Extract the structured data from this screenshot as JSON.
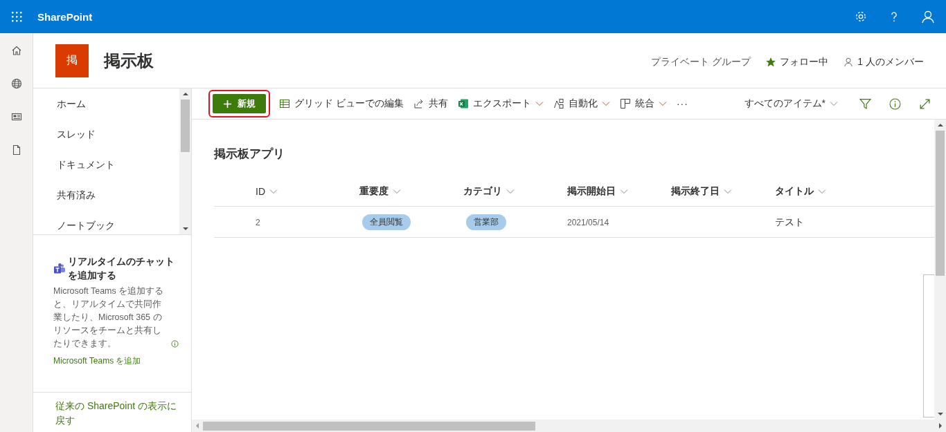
{
  "app_bar": {
    "title": "SharePoint"
  },
  "site": {
    "logo_letter": "掲",
    "title": "掲示板",
    "privacy": "プライベート グループ",
    "follow": {
      "label": "フォロー中",
      "following": true
    },
    "members": "1 人のメンバー"
  },
  "nav": {
    "items": [
      {
        "label": "ホーム"
      },
      {
        "label": "スレッド"
      },
      {
        "label": "ドキュメント"
      },
      {
        "label": "共有済み"
      },
      {
        "label": "ノートブック"
      }
    ],
    "teams_promo": {
      "heading": "リアルタイムのチャットを追加する",
      "body": "Microsoft Teams を追加すると、リアルタイムで共同作業したり、Microsoft 365 のリソースをチームと共有したりできます。",
      "link": "Microsoft Teams を追加"
    },
    "classic_link": "従来の SharePoint の表示に戻す"
  },
  "command_bar": {
    "new_button": {
      "label": "新規",
      "highlighted": true
    },
    "items": [
      {
        "kind": "grid",
        "label": "グリッド ビューでの編集",
        "dropdown": false
      },
      {
        "kind": "share",
        "label": "共有",
        "dropdown": false
      },
      {
        "kind": "excel",
        "label": "エクスポート",
        "dropdown": true
      },
      {
        "kind": "flow",
        "label": "自動化",
        "dropdown": true
      },
      {
        "kind": "integrate",
        "label": "統合",
        "dropdown": true
      },
      {
        "kind": "more",
        "label": "···",
        "dropdown": false
      }
    ],
    "view": "すべてのアイテム*"
  },
  "list": {
    "title": "掲示板アプリ",
    "columns": [
      "ID",
      "重要度",
      "カテゴリ",
      "掲示開始日",
      "掲示終了日",
      "タイトル"
    ],
    "rows": [
      {
        "cells": [
          {
            "kind": "text",
            "value": "2"
          },
          {
            "kind": "pill",
            "value": "全員閲覧"
          },
          {
            "kind": "pill",
            "value": "営業部"
          },
          {
            "kind": "text",
            "value": "2021/05/14"
          },
          {
            "kind": "empty"
          },
          {
            "kind": "title",
            "value": "テスト"
          }
        ]
      }
    ]
  }
}
